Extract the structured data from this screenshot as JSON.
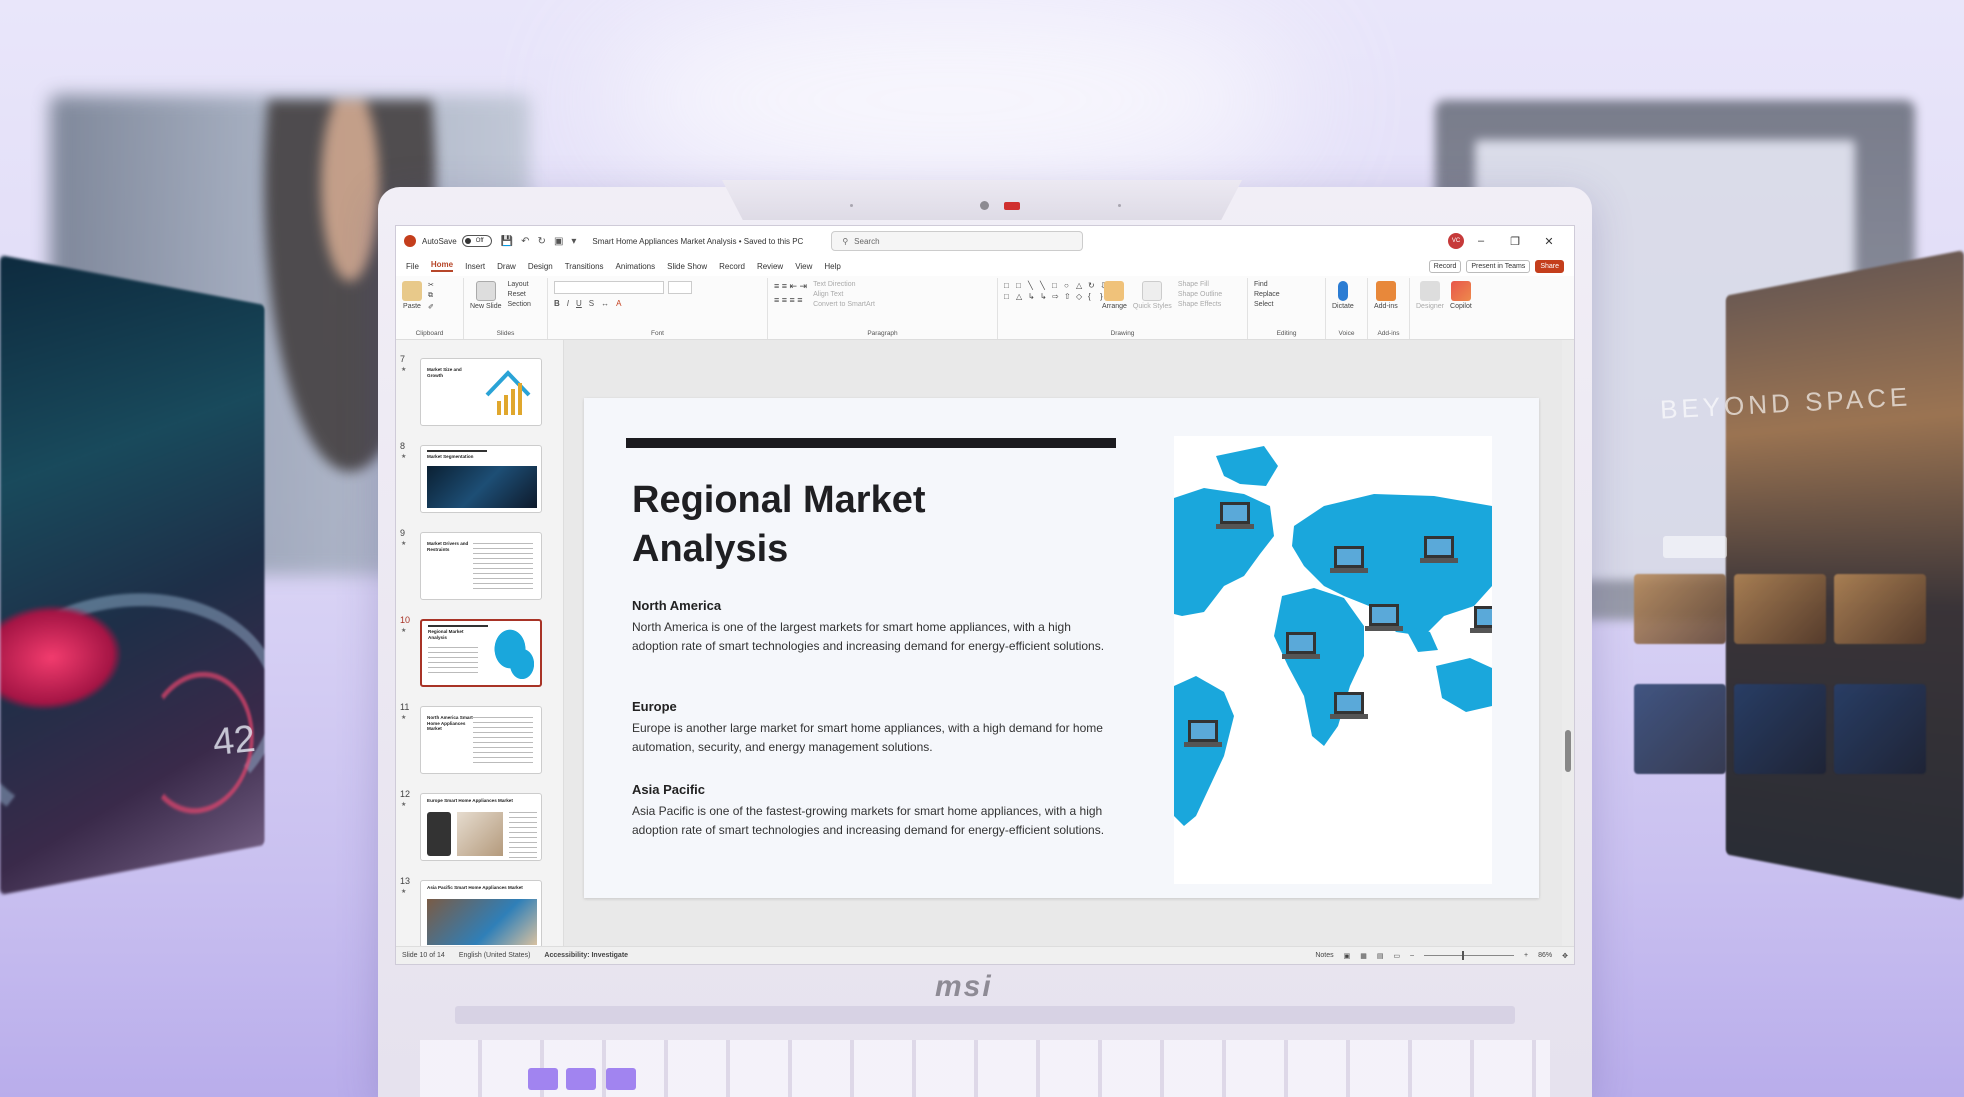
{
  "background": {
    "left_panel_gauge": "42",
    "right_panel_title": "BEYOND SPACE"
  },
  "laptop": {
    "brand": "msi"
  },
  "window": {
    "autosave_label": "AutoSave",
    "autosave_state": "Off",
    "document_title": "Smart Home Appliances Market Analysis • Saved to this PC",
    "search_placeholder": "Search",
    "user_initials": "VC"
  },
  "menu": {
    "tabs": [
      "File",
      "Home",
      "Insert",
      "Draw",
      "Design",
      "Transitions",
      "Animations",
      "Slide Show",
      "Record",
      "Review",
      "View",
      "Help"
    ],
    "active_tab": "Home",
    "record": "Record",
    "present_in_teams": "Present in Teams",
    "share": "Share"
  },
  "ribbon": {
    "paste": "Paste",
    "clipboard": "Clipboard",
    "new_slide": "New Slide",
    "layout": "Layout",
    "reset": "Reset",
    "section": "Section",
    "slides": "Slides",
    "font": "Font",
    "text_direction": "Text Direction",
    "align_text": "Align Text",
    "convert_smartart": "Convert to SmartArt",
    "paragraph": "Paragraph",
    "arrange": "Arrange",
    "quick_styles": "Quick Styles",
    "shape_fill": "Shape Fill",
    "shape_outline": "Shape Outline",
    "shape_effects": "Shape Effects",
    "drawing": "Drawing",
    "find": "Find",
    "replace": "Replace",
    "select": "Select",
    "editing": "Editing",
    "dictate": "Dictate",
    "voice": "Voice",
    "add_ins": "Add-ins",
    "add_ins_group": "Add-ins",
    "designer": "Designer",
    "copilot": "Copilot"
  },
  "thumbnails": [
    {
      "num": "7",
      "title": "Market Size and Growth"
    },
    {
      "num": "8",
      "title": "Market Segmentation"
    },
    {
      "num": "9",
      "title": "Market Drivers and Restraints"
    },
    {
      "num": "10",
      "title": "Regional Market Analysis"
    },
    {
      "num": "11",
      "title": "North America Smart Home Appliances Market"
    },
    {
      "num": "12",
      "title": "Europe Smart Home Appliances Market"
    },
    {
      "num": "13",
      "title": "Asia Pacific Smart Home Appliances Market"
    }
  ],
  "slide": {
    "title": "Regional Market Analysis",
    "sections": [
      {
        "heading": "North America",
        "body": "North America is one of the largest markets for smart home appliances, with a high adoption rate of smart technologies and increasing demand for energy-efficient solutions."
      },
      {
        "heading": "Europe",
        "body": "Europe is another large market for smart home appliances, with a high demand for home automation, security, and energy management solutions."
      },
      {
        "heading": "Asia Pacific",
        "body": "Asia Pacific is one of the fastest-growing markets for smart home appliances, with a high adoption rate of smart technologies and increasing demand for energy-efficient solutions."
      }
    ]
  },
  "status": {
    "slide_count": "Slide 10 of 14",
    "language": "English (United States)",
    "accessibility": "Accessibility: Investigate",
    "notes": "Notes",
    "zoom": "86%"
  },
  "colors": {
    "accent": "#c43e1c",
    "map_blue": "#1aa7dc",
    "title_dark": "#1f1f22"
  }
}
